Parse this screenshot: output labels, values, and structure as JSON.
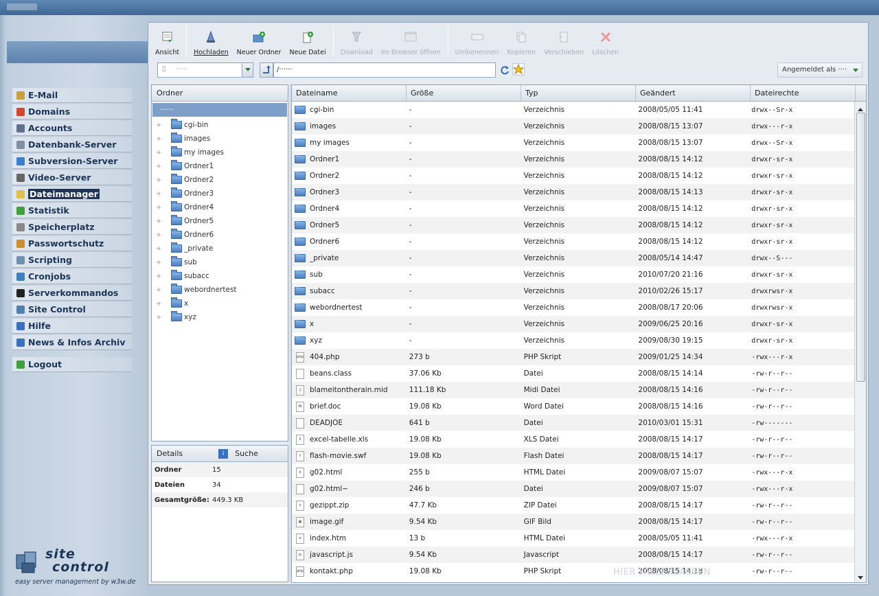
{
  "window": {
    "title": "‧‧‧‧‧‧‧‧‧"
  },
  "sidebar": {
    "items": [
      {
        "label": "E-Mail",
        "icon": "email-icon",
        "color": "#c8a040"
      },
      {
        "label": "Domains",
        "icon": "domains-icon",
        "color": "#d04830"
      },
      {
        "label": "Accounts",
        "icon": "accounts-icon",
        "color": "#607090"
      },
      {
        "label": "Datenbank-Server",
        "icon": "database-icon",
        "color": "#8090a0"
      },
      {
        "label": "Subversion-Server",
        "icon": "subversion-icon",
        "color": "#3a7fd0"
      },
      {
        "label": "Video-Server",
        "icon": "video-icon",
        "color": "#666666"
      },
      {
        "label": "Dateimanager",
        "icon": "folder-icon",
        "color": "#e0c050",
        "active": true
      },
      {
        "label": "Statistik",
        "icon": "statistics-icon",
        "color": "#40a040"
      },
      {
        "label": "Speicherplatz",
        "icon": "disk-icon",
        "color": "#888888"
      },
      {
        "label": "Passwortschutz",
        "icon": "lock-icon",
        "color": "#c89030"
      },
      {
        "label": "Scripting",
        "icon": "scripting-icon",
        "color": "#7090b0"
      },
      {
        "label": "Cronjobs",
        "icon": "clock-icon",
        "color": "#4080c0"
      },
      {
        "label": "Serverkommandos",
        "icon": "terminal-icon",
        "color": "#222222"
      },
      {
        "label": "Site Control",
        "icon": "site-control-icon",
        "color": "#5080b0"
      },
      {
        "label": "Hilfe",
        "icon": "help-icon",
        "color": "#3a70c0"
      },
      {
        "label": "News & Infos Archiv",
        "icon": "info-icon",
        "color": "#3a70c0"
      }
    ],
    "logout": {
      "label": "Logout",
      "icon": "logout-icon",
      "color": "#40a040"
    }
  },
  "logo": {
    "line1": "site",
    "line2": "control",
    "tagline": "easy server management by w3w.de"
  },
  "toolbar": {
    "ansicht": "Ansicht",
    "hochladen": "Hochladen",
    "neuer_ordner": "Neuer Ordner",
    "neue_datei": "Neue Datei",
    "download": "Download",
    "browser": "Im Browser öffnen",
    "umbenennen": "Umbenennen",
    "kopieren": "Kopieren",
    "verschieben": "Verschieben",
    "loeschen": "Löschen"
  },
  "address": {
    "domain": "‧‧‧‧‧‧",
    "path": "/‧‧‧‧‧‧",
    "login": "Angemeldet als ‧‧‧‧"
  },
  "folders": {
    "header": "Ordner",
    "root": "‧‧‧‧‧‧",
    "items": [
      "cgi-bin",
      "images",
      "my images",
      "Ordner1",
      "Ordner2",
      "Ordner3",
      "Ordner4",
      "Ordner5",
      "Ordner6",
      "_private",
      "sub",
      "subacc",
      "webordnertest",
      "x",
      "xyz"
    ]
  },
  "details": {
    "tab_details": "Details",
    "tab_search": "Suche",
    "rows": [
      {
        "k": "Ordner",
        "v": "15"
      },
      {
        "k": "Dateien",
        "v": "34"
      },
      {
        "k": "Gesamtgröße:",
        "v": "449.3 KB"
      }
    ]
  },
  "files": {
    "columns": [
      "Dateiname",
      "Größe",
      "Typ",
      "Geändert",
      "Dateirechte"
    ],
    "rows": [
      {
        "name": "cgi-bin",
        "size": "-",
        "type": "Verzeichnis",
        "date": "2008/05/05 11:41",
        "perm": "drwx--Sr-x",
        "kind": "folder"
      },
      {
        "name": "images",
        "size": "-",
        "type": "Verzeichnis",
        "date": "2008/08/15 13:07",
        "perm": "drwx---r-x",
        "kind": "folder"
      },
      {
        "name": "my images",
        "size": "-",
        "type": "Verzeichnis",
        "date": "2008/08/15 13:07",
        "perm": "drwx--Sr-x",
        "kind": "folder"
      },
      {
        "name": "Ordner1",
        "size": "-",
        "type": "Verzeichnis",
        "date": "2008/08/15 14:12",
        "perm": "drwxr-sr-x",
        "kind": "folder"
      },
      {
        "name": "Ordner2",
        "size": "-",
        "type": "Verzeichnis",
        "date": "2008/08/15 14:12",
        "perm": "drwxr-sr-x",
        "kind": "folder"
      },
      {
        "name": "Ordner3",
        "size": "-",
        "type": "Verzeichnis",
        "date": "2008/08/15 14:13",
        "perm": "drwxr-sr-x",
        "kind": "folder"
      },
      {
        "name": "Ordner4",
        "size": "-",
        "type": "Verzeichnis",
        "date": "2008/08/15 14:12",
        "perm": "drwxr-sr-x",
        "kind": "folder"
      },
      {
        "name": "Ordner5",
        "size": "-",
        "type": "Verzeichnis",
        "date": "2008/08/15 14:12",
        "perm": "drwxr-sr-x",
        "kind": "folder"
      },
      {
        "name": "Ordner6",
        "size": "-",
        "type": "Verzeichnis",
        "date": "2008/08/15 14:12",
        "perm": "drwxr-sr-x",
        "kind": "folder"
      },
      {
        "name": "_private",
        "size": "-",
        "type": "Verzeichnis",
        "date": "2008/05/14 14:47",
        "perm": "drwx--S---",
        "kind": "folder"
      },
      {
        "name": "sub",
        "size": "-",
        "type": "Verzeichnis",
        "date": "2010/07/20 21:16",
        "perm": "drwxr-sr-x",
        "kind": "folder"
      },
      {
        "name": "subacc",
        "size": "-",
        "type": "Verzeichnis",
        "date": "2010/02/26 15:17",
        "perm": "drwxrwsr-x",
        "kind": "folder"
      },
      {
        "name": "webordnertest",
        "size": "-",
        "type": "Verzeichnis",
        "date": "2008/08/17 20:06",
        "perm": "drwxrwsr-x",
        "kind": "folder"
      },
      {
        "name": "x",
        "size": "-",
        "type": "Verzeichnis",
        "date": "2009/06/25 20:16",
        "perm": "drwxr-sr-x",
        "kind": "folder"
      },
      {
        "name": "xyz",
        "size": "-",
        "type": "Verzeichnis",
        "date": "2009/08/30 19:15",
        "perm": "drwxr-sr-x",
        "kind": "folder"
      },
      {
        "name": "404.php",
        "size": "273 b",
        "type": "PHP Skript",
        "date": "2009/01/25 14:34",
        "perm": "-rwx---r-x",
        "kind": "php"
      },
      {
        "name": "beans.class",
        "size": "37.06 Kb",
        "type": "Datei",
        "date": "2008/08/15 14:14",
        "perm": "-rw-r--r--",
        "kind": "file"
      },
      {
        "name": "blameitontherain.mid",
        "size": "111.18 Kb",
        "type": "Midi Datei",
        "date": "2008/08/15 14:16",
        "perm": "-rw-r--r--",
        "kind": "midi"
      },
      {
        "name": "brief.doc",
        "size": "19.08 Kb",
        "type": "Word Datei",
        "date": "2008/08/15 14:16",
        "perm": "-rw-r--r--",
        "kind": "doc"
      },
      {
        "name": "DEADJOE",
        "size": "641 b",
        "type": "Datei",
        "date": "2010/03/01 15:31",
        "perm": "-rw-------",
        "kind": "file"
      },
      {
        "name": "excel-tabelle.xls",
        "size": "19.08 Kb",
        "type": "XLS Datei",
        "date": "2008/08/15 14:17",
        "perm": "-rw-r--r--",
        "kind": "xls"
      },
      {
        "name": "flash-movie.swf",
        "size": "19.08 Kb",
        "type": "Flash Datei",
        "date": "2008/08/15 14:17",
        "perm": "-rw-r--r--",
        "kind": "swf"
      },
      {
        "name": "g02.html",
        "size": "255 b",
        "type": "HTML Datei",
        "date": "2009/08/07 15:07",
        "perm": "-rwx---r-x",
        "kind": "html"
      },
      {
        "name": "g02.html~",
        "size": "246 b",
        "type": "Datei",
        "date": "2009/08/07 15:07",
        "perm": "-rwx---r-x",
        "kind": "file"
      },
      {
        "name": "gezippt.zip",
        "size": "47.7 Kb",
        "type": "ZIP Datei",
        "date": "2008/08/15 14:17",
        "perm": "-rw-r--r--",
        "kind": "zip"
      },
      {
        "name": "image.gif",
        "size": "9.54 Kb",
        "type": "GIF Bild",
        "date": "2008/08/15 14:17",
        "perm": "-rw-r--r--",
        "kind": "gif"
      },
      {
        "name": "index.htm",
        "size": "13 b",
        "type": "HTML Datei",
        "date": "2008/05/05 11:41",
        "perm": "-rwx---r-x",
        "kind": "html"
      },
      {
        "name": "javascript.js",
        "size": "9.54 Kb",
        "type": "Javascript",
        "date": "2008/08/15 14:17",
        "perm": "-rw-r--r--",
        "kind": "js"
      },
      {
        "name": "kontakt.php",
        "size": "19.08 Kb",
        "type": "PHP Skript",
        "date": "2008/08/15 14:18",
        "perm": "-rw-r--r--",
        "kind": "php"
      }
    ]
  },
  "drop_hint": "HIER FALLENLASSEN",
  "colors": {
    "accent": "#1f3558",
    "selected": "#7ea0c8",
    "folder": "#4a7fc0"
  }
}
